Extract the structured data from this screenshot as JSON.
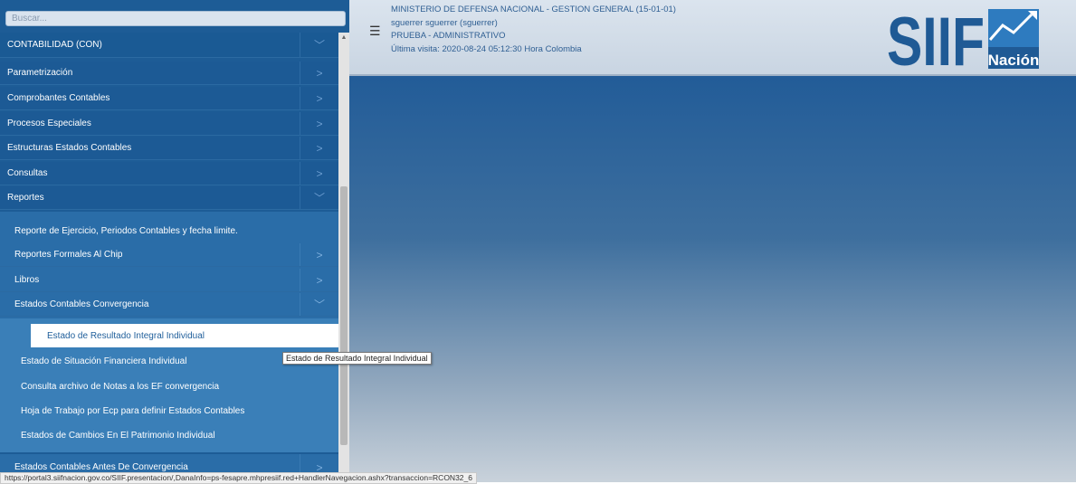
{
  "search": {
    "placeholder": "Buscar..."
  },
  "sidebar": {
    "module": "CONTABILIDAD (CON)",
    "items": [
      {
        "label": "Parametrización"
      },
      {
        "label": "Comprobantes Contables"
      },
      {
        "label": "Procesos Especiales"
      },
      {
        "label": "Estructuras Estados Contables"
      },
      {
        "label": "Consultas"
      },
      {
        "label": "Reportes"
      }
    ],
    "reportes_children": [
      {
        "label": "Reporte de Ejercicio, Periodos Contables y fecha limite."
      },
      {
        "label": "Reportes Formales Al Chip"
      },
      {
        "label": "Libros"
      },
      {
        "label": "Estados Contables Convergencia"
      }
    ],
    "convergencia_children": [
      {
        "label": "Estado de Resultado Integral Individual"
      },
      {
        "label": "Estado de Situación Financiera Individual"
      },
      {
        "label": "Consulta archivo de Notas a los EF convergencia"
      },
      {
        "label": "Hoja de Trabajo por Ecp para definir Estados Contables"
      },
      {
        "label": "Estados de Cambios En El Patrimonio Individual"
      }
    ],
    "after": [
      {
        "label": "Estados Contables Antes De Convergencia"
      }
    ]
  },
  "header": {
    "entity": "MINISTERIO DE DEFENSA NACIONAL - GESTION GENERAL (15-01-01)",
    "user": "sguerrer sguerrer (sguerrer)",
    "profile": "PRUEBA - ADMINISTRATIVO",
    "last_visit": "Última visita: 2020-08-24 05:12:30 Hora Colombia"
  },
  "logo": {
    "text": "SIIF",
    "subtext": "Nación"
  },
  "tooltip": "Estado de Resultado Integral Individual",
  "status_url": "https://portal3.siifnacion.gov.co/SIIF.presentacion/,DanaInfo=ps-fesapre.mhpresiif.red+HandlerNavegacion.ashx?transaccion=RCON32_6",
  "colors": {
    "sidebar": "#1d5c96",
    "header": "#d5dfea",
    "accent": "#2f5f93"
  }
}
